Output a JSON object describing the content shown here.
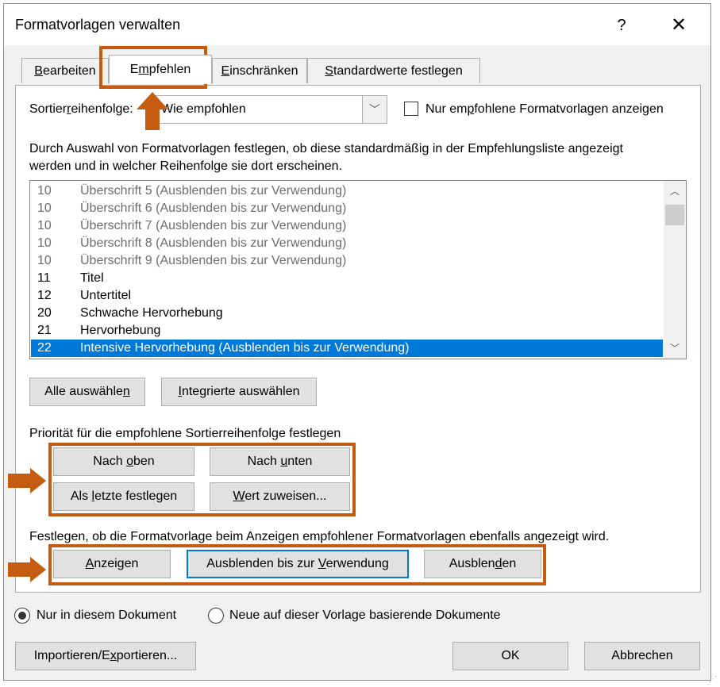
{
  "window": {
    "title": "Formatvorlagen verwalten",
    "help": "?",
    "close": "✕"
  },
  "tabs": [
    {
      "pre": "",
      "acc": "B",
      "post": "earbeiten"
    },
    {
      "pre": "E",
      "acc": "m",
      "post": "pfehlen"
    },
    {
      "pre": "",
      "acc": "E",
      "post": "inschränken"
    },
    {
      "pre": "",
      "acc": "S",
      "post": "tandardwerte festlegen"
    }
  ],
  "sort": {
    "label_pre": "Sortier",
    "label_acc": "r",
    "label_post": "eihenfolge:",
    "value": "Wie empfohlen",
    "only_pre": "Nur em",
    "only_acc": "p",
    "only_post": "fohlene Formatvorlagen anzeigen"
  },
  "description": {
    "line1": "Durch Auswahl von Formatvorlagen festlegen, ob diese standardmäßig in der Empfehlungsliste angezeigt",
    "line2": "werden und in welcher Reihenfolge sie dort erscheinen."
  },
  "styles": [
    {
      "num": "10",
      "name": "Überschrift 5  (Ausblenden bis zur Verwendung)"
    },
    {
      "num": "10",
      "name": "Überschrift 6  (Ausblenden bis zur Verwendung)"
    },
    {
      "num": "10",
      "name": "Überschrift 7  (Ausblenden bis zur Verwendung)"
    },
    {
      "num": "10",
      "name": "Überschrift 8  (Ausblenden bis zur Verwendung)"
    },
    {
      "num": "10",
      "name": "Überschrift 9  (Ausblenden bis zur Verwendung)"
    },
    {
      "num": "11",
      "name": "Titel"
    },
    {
      "num": "12",
      "name": "Untertitel"
    },
    {
      "num": "20",
      "name": "Schwache Hervorhebung"
    },
    {
      "num": "21",
      "name": "Hervorhebung"
    },
    {
      "num": "22",
      "name": "Intensive Hervorhebung  (Ausblenden bis zur Verwendung)"
    }
  ],
  "select_buttons": {
    "all_pre": "Alle auswähle",
    "all_acc": "n",
    "all_post": "",
    "builtin_pre": "",
    "builtin_acc": "I",
    "builtin_post": "ntegrierte auswählen"
  },
  "priority": {
    "label": "Priorität für die empfohlene Sortierreihenfolge festlegen",
    "up_pre": "Nach ",
    "up_acc": "o",
    "up_post": "ben",
    "down_pre": "Nach ",
    "down_acc": "u",
    "down_post": "nten",
    "last_pre": "Als ",
    "last_acc": "l",
    "last_post": "etzte festlegen",
    "assign_pre": "",
    "assign_acc": "W",
    "assign_post": "ert zuweisen..."
  },
  "visibility": {
    "label": "Festlegen, ob die Formatvorlage beim Anzeigen empfohlener Formatvorlagen ebenfalls angezeigt wird.",
    "show_pre": "",
    "show_acc": "A",
    "show_post": "nzeigen",
    "hideuse_pre": "Ausblenden bis zur ",
    "hideuse_acc": "V",
    "hideuse_post": "erwendung",
    "hide_pre": "Ausblen",
    "hide_acc": "d",
    "hide_post": "en"
  },
  "scope": {
    "doc_only": "Nur in diesem Dokument",
    "new_docs": "Neue auf dieser Vorlage basierende Dokumente"
  },
  "footer": {
    "import_pre": "Importieren/E",
    "import_acc": "x",
    "import_post": "portieren...",
    "ok": "OK",
    "cancel": "Abbrechen"
  },
  "colors": {
    "accent": "#c55a11",
    "selection": "#0078d7",
    "hidden_text": "#6d6d6d"
  }
}
